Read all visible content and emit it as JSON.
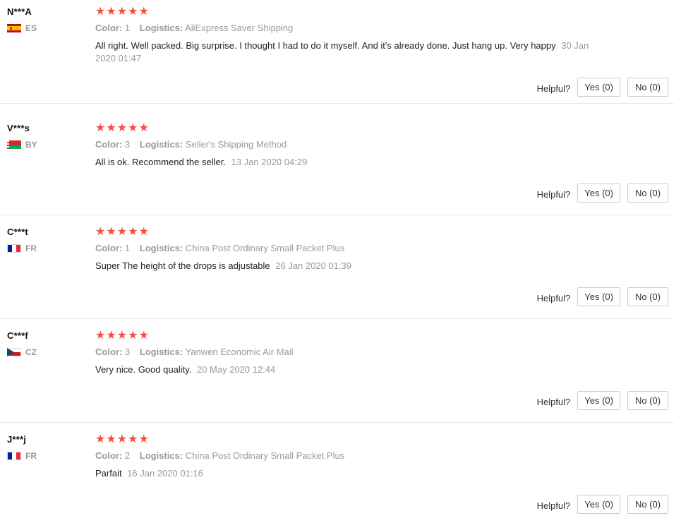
{
  "helpful_label": "Helpful?",
  "labels": {
    "color": "Color:",
    "logistics": "Logistics:"
  },
  "star_color": "#f44d40",
  "reviews": [
    {
      "user": "N***A",
      "country": "ES",
      "flag_icon": "spain-flag-icon",
      "rating": 5,
      "color": "1",
      "logistics": "AliExpress Saver Shipping",
      "text": "All right. Well packed. Big surprise. I thought I had to do it myself. And it's already done. Just hang up. Very happy",
      "date": "30 Jan 2020 01:47",
      "yes_label": "Yes (0)",
      "no_label": "No (0)"
    },
    {
      "user": "V***s",
      "country": "BY",
      "flag_icon": "belarus-flag-icon",
      "rating": 5,
      "color": "3",
      "logistics": "Seller's Shipping Method",
      "text": "All is ok. Recommend the seller.",
      "date": "13 Jan 2020 04:29",
      "yes_label": "Yes (0)",
      "no_label": "No (0)"
    },
    {
      "user": "C***t",
      "country": "FR",
      "flag_icon": "france-flag-icon",
      "rating": 5,
      "color": "1",
      "logistics": "China Post Ordinary Small Packet Plus",
      "text": "Super The height of the drops is adjustable",
      "date": "26 Jan 2020 01:39",
      "yes_label": "Yes (0)",
      "no_label": "No (0)"
    },
    {
      "user": "C***f",
      "country": "CZ",
      "flag_icon": "czech-flag-icon",
      "rating": 5,
      "color": "3",
      "logistics": "Yanwen Economic Air Mail",
      "text": "Very nice. Good quality.",
      "date": "20 May 2020 12:44",
      "yes_label": "Yes (0)",
      "no_label": "No (0)"
    },
    {
      "user": "J***j",
      "country": "FR",
      "flag_icon": "france-flag-icon",
      "rating": 5,
      "color": "2",
      "logistics": "China Post Ordinary Small Packet Plus",
      "text": "Parfait",
      "date": "16 Jan 2020 01:16",
      "yes_label": "Yes (0)",
      "no_label": "No (0)"
    }
  ]
}
